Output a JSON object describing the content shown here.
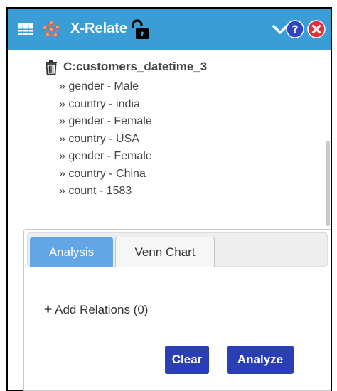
{
  "header": {
    "title": "X-Relate",
    "icons": [
      "table-icon",
      "network-icon",
      "unlock-icon",
      "chevron-down-icon",
      "help-icon",
      "close-icon"
    ],
    "background_color": "#3b9dd6"
  },
  "tree": {
    "root_label": "C:customers_datetime_3",
    "root_icon": "trash-icon",
    "items": [
      "» gender - Male",
      "» country - india",
      "» gender - Female",
      "» country - USA",
      "» gender - Female",
      "» country - China",
      "» count - 1583"
    ]
  },
  "tabs": [
    {
      "label": "Analysis",
      "active": true
    },
    {
      "label": "Venn Chart",
      "active": false
    }
  ],
  "analysis": {
    "add_relations_label": "Add Relations (0)"
  },
  "buttons": {
    "clear": "Clear",
    "analyze": "Analyze"
  },
  "colors": {
    "active_tab": "#62a6e5",
    "button": "#2b3fb5",
    "close_icon": "#e0303a",
    "help_icon": "#2f45c6"
  }
}
